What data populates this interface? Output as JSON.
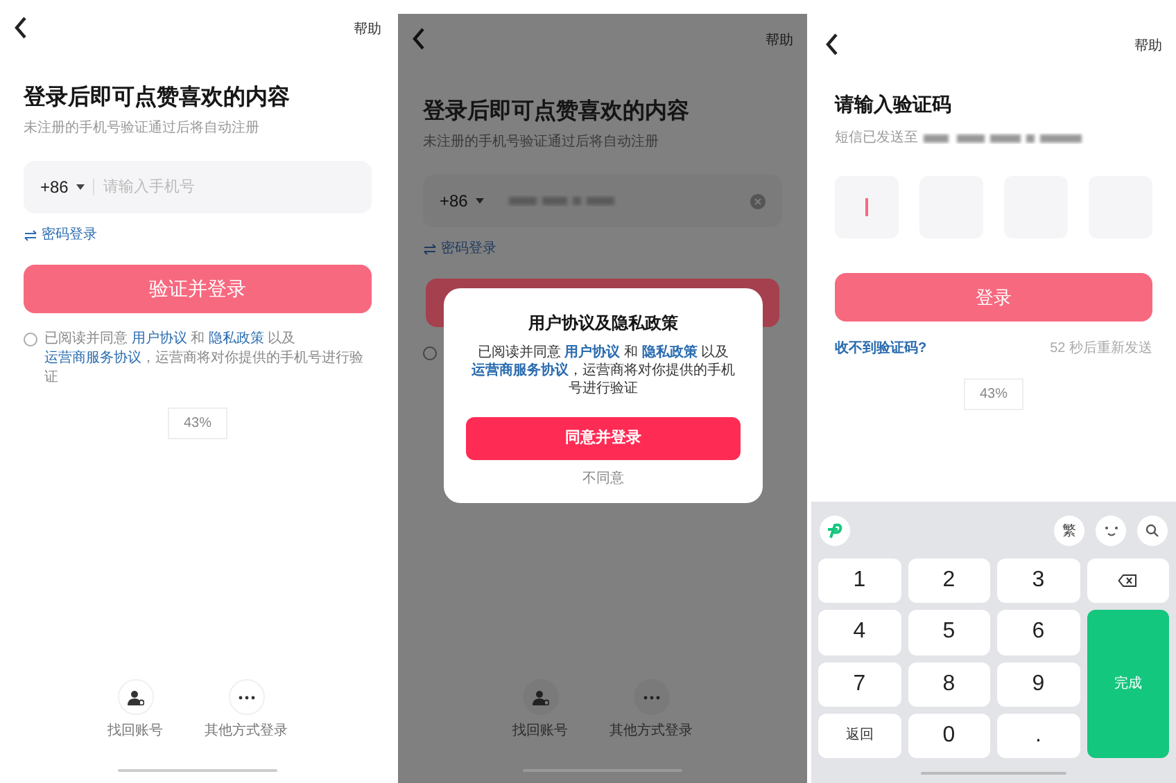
{
  "login_screen": {
    "help": "帮助",
    "title": "登录后即可点赞喜欢的内容",
    "subtitle": "未注册的手机号验证通过后将自动注册",
    "country_code": "+86",
    "phone_placeholder": "请输入手机号",
    "password_login": "密码登录",
    "submit": "验证并登录",
    "agreement_checked": false,
    "agreement": [
      {
        "kind": "text",
        "text": "已阅读并同意 "
      },
      {
        "kind": "link",
        "text": "用户协议"
      },
      {
        "kind": "text",
        "text": " 和 "
      },
      {
        "kind": "link",
        "text": "隐私政策"
      },
      {
        "kind": "text",
        "text": " 以及 "
      },
      {
        "kind": "link",
        "text": "运营商服务协议"
      },
      {
        "kind": "text",
        "text": "，运营商将对你提供的手机号进行验证"
      }
    ],
    "progress": "43%",
    "bottom_actions": [
      {
        "kind": "recover",
        "label": "找回账号"
      },
      {
        "kind": "more",
        "label": "其他方式登录"
      }
    ]
  },
  "consent_screen": {
    "help": "帮助",
    "title": "登录后即可点赞喜欢的内容",
    "subtitle": "未注册的手机号验证通过后将自动注册",
    "country_code": "+86",
    "password_login": "密码登录",
    "agreement_checked": false,
    "dialog": {
      "title": "用户协议及隐私政策",
      "body": [
        {
          "kind": "text",
          "text": "已阅读并同意 "
        },
        {
          "kind": "link",
          "text": "用户协议"
        },
        {
          "kind": "text",
          "text": " 和 "
        },
        {
          "kind": "link",
          "text": "隐私政策"
        },
        {
          "kind": "text",
          "text": " 以及 "
        },
        {
          "kind": "link",
          "text": "运营商服务协议"
        },
        {
          "kind": "text",
          "text": "，运营商将对你提供的手机号进行验证"
        }
      ],
      "confirm": "同意并登录",
      "decline": "不同意"
    },
    "bottom_actions": [
      {
        "kind": "recover",
        "label": "找回账号"
      },
      {
        "kind": "more",
        "label": "其他方式登录"
      }
    ]
  },
  "code_screen": {
    "help": "帮助",
    "title": "请输入验证码",
    "sent_to": "短信已发送至",
    "code_boxes": [
      {
        "focused": true
      },
      {
        "focused": false
      },
      {
        "focused": false
      },
      {
        "focused": false
      }
    ],
    "submit": "登录",
    "no_code": "收不到验证码?",
    "countdown": "52 秒后重新发送",
    "progress": "43%",
    "keyboard": {
      "toolbar": [
        {
          "kind": "logo"
        },
        {
          "kind": "text",
          "label": "繁"
        },
        {
          "kind": "emoji"
        },
        {
          "kind": "search"
        }
      ],
      "keys": [
        {
          "kind": "digit",
          "label": "1"
        },
        {
          "kind": "digit",
          "label": "2"
        },
        {
          "kind": "digit",
          "label": "3"
        },
        {
          "kind": "backspace"
        },
        {
          "kind": "digit",
          "label": "4"
        },
        {
          "kind": "digit",
          "label": "5"
        },
        {
          "kind": "digit",
          "label": "6"
        },
        {
          "kind": "digit",
          "label": "7"
        },
        {
          "kind": "digit",
          "label": "8"
        },
        {
          "kind": "digit",
          "label": "9"
        },
        {
          "kind": "done",
          "label": "完成"
        },
        {
          "kind": "small",
          "label": "返回"
        },
        {
          "kind": "digit",
          "label": "0"
        },
        {
          "kind": "digit",
          "label": "."
        }
      ]
    }
  }
}
